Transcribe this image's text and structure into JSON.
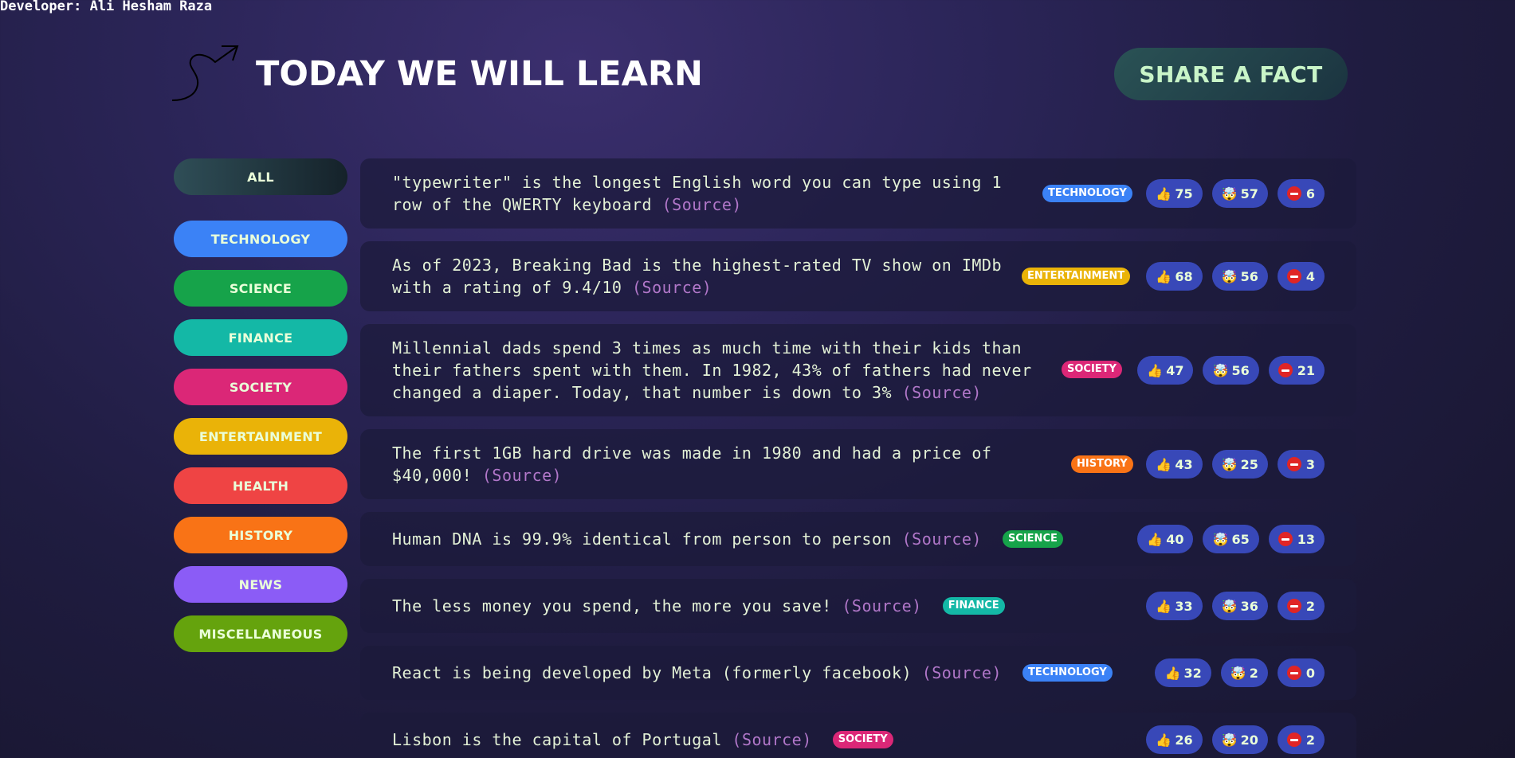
{
  "developer_credit": "Developer: Ali Hesham Raza",
  "header": {
    "title": "Today we will learn",
    "share_button": "Share a fact",
    "logo_icon": "curved-arrow-icon"
  },
  "categories": [
    {
      "label": "All",
      "color": "#2f4e57"
    },
    {
      "label": "technology",
      "color": "#3b82f6"
    },
    {
      "label": "science",
      "color": "#16a34a"
    },
    {
      "label": "finance",
      "color": "#14b8a6"
    },
    {
      "label": "society",
      "color": "#db2777"
    },
    {
      "label": "entertainment",
      "color": "#eab308"
    },
    {
      "label": "health",
      "color": "#ef4444"
    },
    {
      "label": "history",
      "color": "#f97316"
    },
    {
      "label": "news",
      "color": "#8b5cf6"
    },
    {
      "label": "miscellaneous",
      "color": "#65a30d"
    }
  ],
  "facts": [
    {
      "text": "\"typewriter\" is the longest English word you can type using 1 row of the QWERTY keyboard",
      "source": "(Source)",
      "tag": "technology",
      "tag_color": "#3b82f6",
      "interesting": "75",
      "mindblowing": "57",
      "false": "6"
    },
    {
      "text": "As of 2023, Breaking Bad is the highest-rated TV show on IMDb with a rating of 9.4/10",
      "source": "(Source)",
      "tag": "entertainment",
      "tag_color": "#eab308",
      "interesting": "68",
      "mindblowing": "56",
      "false": "4"
    },
    {
      "text": "Millennial dads spend 3 times as much time with their kids than their fathers spent with them. In 1982, 43% of fathers had never changed a diaper. Today, that number is down to 3%",
      "source": "(Source)",
      "tag": "society",
      "tag_color": "#db2777",
      "interesting": "47",
      "mindblowing": "56",
      "false": "21"
    },
    {
      "text": "The first 1GB hard drive was made in 1980 and had a price of $40,000!",
      "source": "(Source)",
      "tag": "history",
      "tag_color": "#f97316",
      "interesting": "43",
      "mindblowing": "25",
      "false": "3"
    },
    {
      "text": "Human DNA is 99.9% identical from person to person",
      "source": "(Source)",
      "tag": "science",
      "tag_color": "#16a34a",
      "interesting": "40",
      "mindblowing": "65",
      "false": "13"
    },
    {
      "text": "The less money you spend, the more you save!",
      "source": "(Source)",
      "tag": "finance",
      "tag_color": "#14b8a6",
      "interesting": "33",
      "mindblowing": "36",
      "false": "2"
    },
    {
      "text": "React is being developed by Meta (formerly facebook)",
      "source": "(Source)",
      "tag": "technology",
      "tag_color": "#3b82f6",
      "interesting": "32",
      "mindblowing": "2",
      "false": "0"
    },
    {
      "text": "Lisbon is the capital of Portugal",
      "source": "(Source)",
      "tag": "society",
      "tag_color": "#db2777",
      "interesting": "26",
      "mindblowing": "20",
      "false": "2"
    }
  ],
  "vote_icons": {
    "interesting": "thumbs-up-icon",
    "mindblowing": "mind-blown-icon",
    "false": "no-entry-icon"
  }
}
